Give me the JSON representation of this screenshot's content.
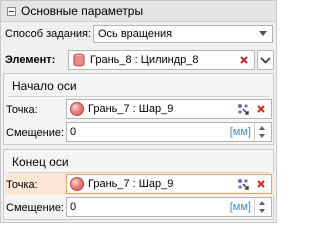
{
  "main_section": {
    "title": "Основные параметры",
    "method_label": "Способ задания:",
    "method_value": "Ось вращения",
    "element_label": "Элемент:",
    "element_value": "Грань_8 : Цилиндр_8"
  },
  "axis_start": {
    "title": "Начало оси",
    "point_label": "Точка:",
    "point_value": "Грань_7 : Шар_9",
    "offset_label": "Смещение:",
    "offset_value": "0",
    "unit": "[мм]"
  },
  "axis_end": {
    "title": "Конец оси",
    "point_label": "Точка:",
    "point_value": "Грань_7 : Шар_9",
    "offset_label": "Смещение:",
    "offset_value": "0",
    "unit": "[мм]"
  },
  "colors": {
    "accent_orange": "#f5a25a",
    "clear_red": "#e02020",
    "unit_blue": "#3c8cd8"
  }
}
